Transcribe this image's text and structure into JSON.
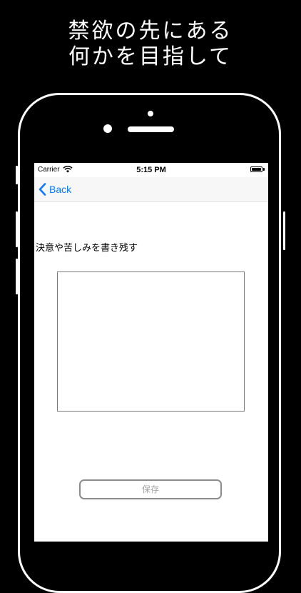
{
  "headline": {
    "line1": "禁欲の先にある",
    "line2": "何かを目指して"
  },
  "statusbar": {
    "carrier": "Carrier",
    "time": "5:15 PM"
  },
  "navbar": {
    "back_label": "Back"
  },
  "main": {
    "prompt_label": "決意や苦しみを書き残す",
    "memo_value": "",
    "save_label": "保存"
  },
  "colors": {
    "accent": "#0a7aff",
    "background": "#000000",
    "screen": "#ffffff"
  },
  "icons": {
    "back": "chevron-left-icon",
    "wifi": "wifi-icon",
    "battery": "battery-icon"
  }
}
